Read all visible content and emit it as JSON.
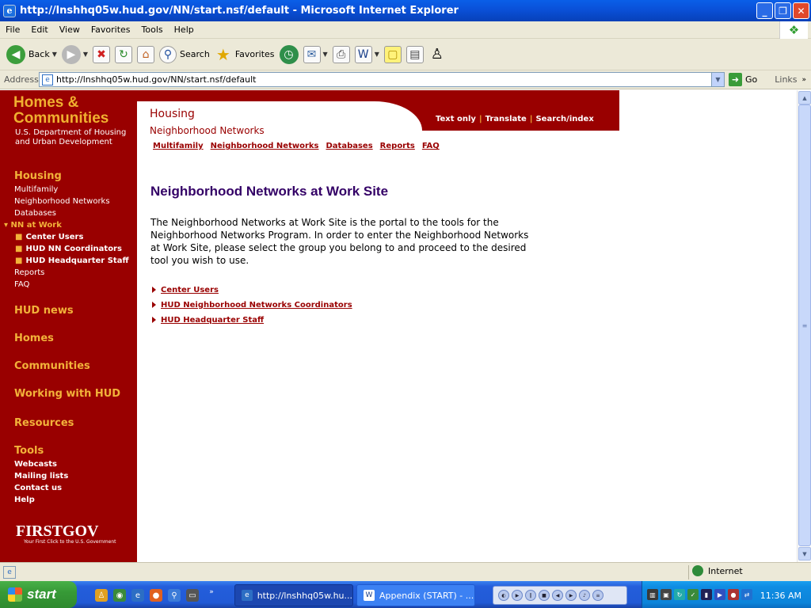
{
  "window": {
    "title": "http://lnshhq05w.hud.gov/NN/start.nsf/default - Microsoft Internet Explorer",
    "min_label": "_",
    "max_label": "❐",
    "close_label": "✕"
  },
  "menu": [
    "File",
    "Edit",
    "View",
    "Favorites",
    "Tools",
    "Help"
  ],
  "toolbar": {
    "back_label": "Back",
    "search_label": "Search",
    "favorites_label": "Favorites"
  },
  "address": {
    "label": "Address",
    "url": "http://lnshhq05w.hud.gov/NN/start.nsf/default",
    "go_label": "Go",
    "links_label": "Links"
  },
  "site": {
    "logo_line1": "Homes &",
    "logo_line2": "Communities",
    "dept_line1": "U.S. Department of Housing",
    "dept_line2": "and Urban Development",
    "header_title": "Housing",
    "header_subtitle": "Neighborhood Networks",
    "top_links": [
      "Text only",
      "Translate",
      "Search/index"
    ],
    "subnav": [
      "Multifamily",
      "Neighborhood Networks",
      "Databases",
      "Reports",
      "FAQ"
    ]
  },
  "leftnav": {
    "housing_head": "Housing",
    "housing_items": [
      "Multifamily",
      "Neighborhood Networks",
      "Databases"
    ],
    "active_item": "NN at Work",
    "active_subitems": [
      "Center Users",
      "HUD NN Coordinators",
      "HUD Headquarter Staff"
    ],
    "more_items": [
      "Reports",
      "FAQ"
    ],
    "sections": [
      "HUD news",
      "Homes",
      "Communities",
      "Working with HUD",
      "Resources"
    ],
    "tools_head": "Tools",
    "tools_items": [
      "Webcasts",
      "Mailing lists",
      "Contact us",
      "Help"
    ],
    "firstgov": "FIRSTGOV",
    "firstgov_tag": "Your First Click to the U.S. Government"
  },
  "main": {
    "title": "Neighborhood Networks at Work Site",
    "intro": "The Neighborhood Networks at Work Site is the portal to the tools for the Neighborhood Networks Program. In order to enter the Neighborhood Networks at Work Site, please select the group you belong to and proceed to the desired tool you wish to use.",
    "links": [
      "Center Users",
      "HUD Neighborhood Networks Coordinators",
      "HUD Headquarter Staff"
    ]
  },
  "status": {
    "zone": "Internet"
  },
  "taskbar": {
    "start_label": "start",
    "tasks": [
      "http://lnshhq05w.hu...",
      "Appendix (START) - ..."
    ],
    "clock": "11:36 AM"
  }
}
